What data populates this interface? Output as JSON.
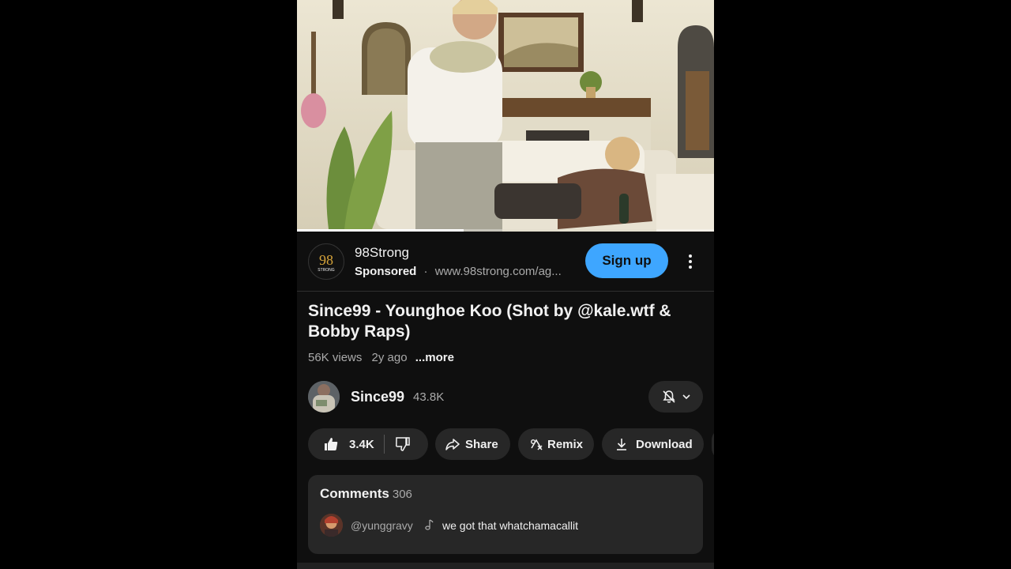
{
  "video": {
    "progress_fraction": 0.4
  },
  "ad": {
    "advertiser": "98Strong",
    "logo_text": "98",
    "logo_subtext": "STRONG",
    "sponsored_label": "Sponsored",
    "separator": "·",
    "url": "www.98strong.com/ag...",
    "cta_label": "Sign up",
    "accent_color": "#3ea6ff"
  },
  "video_info": {
    "title": "Since99 - Younghoe Koo (Shot by @kale.wtf & Bobby Raps)",
    "views": "56K views",
    "age": "2y ago",
    "more_label": "...more"
  },
  "channel": {
    "name": "Since99",
    "subscribers": "43.8K",
    "bell_icon": "bell-off-icon",
    "chevron_icon": "chevron-down-icon"
  },
  "actions": {
    "like_count": "3.4K",
    "share_label": "Share",
    "remix_label": "Remix",
    "download_label": "Download"
  },
  "comments": {
    "header": "Comments",
    "count": "306",
    "top_comment": {
      "user": "@yunggravy",
      "icon": "music-note-icon",
      "text": "we got that whatchamacallit"
    }
  }
}
